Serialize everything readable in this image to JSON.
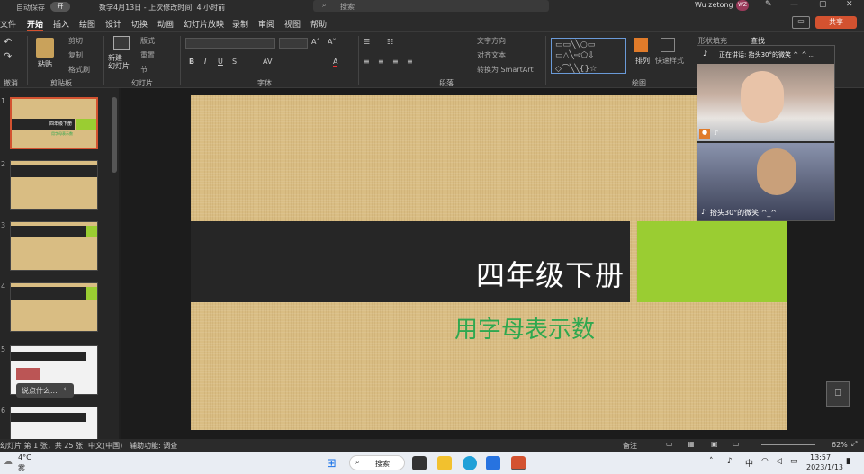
{
  "titlebar": {
    "doc_title": "数学4月13日 - 上次修改时间: 4 小时前",
    "user": "Wu zetong",
    "user_initials": "WZ",
    "autosave_label": "自动保存",
    "autosave_state": "开",
    "search_placeholder": "搜索"
  },
  "menu": [
    "文件",
    "开始",
    "插入",
    "绘图",
    "设计",
    "切换",
    "动画",
    "幻灯片放映",
    "录制",
    "审阅",
    "视图",
    "帮助"
  ],
  "share_label": "共享",
  "ribbon": {
    "groups": [
      {
        "label": "撤消"
      },
      {
        "label": "剪贴板"
      },
      {
        "label": "幻灯片"
      },
      {
        "label": "字体"
      },
      {
        "label": "段落"
      },
      {
        "label": "绘图"
      }
    ],
    "paste": "粘贴",
    "cut": "剪切",
    "copy": "复制",
    "format_painter": "格式刷",
    "new_slide": "新建\n幻灯片",
    "layout": "版式",
    "reset": "重置",
    "section": "节",
    "text_direction": "文字方向",
    "align_text": "对齐文本",
    "smartart": "转换为 SmartArt",
    "arrange": "排列",
    "quick_styles": "快速样式",
    "shape_fill": "形状填充",
    "find": "查找"
  },
  "thumbs": [
    {
      "n": "1"
    },
    {
      "n": "2"
    },
    {
      "n": "3"
    },
    {
      "n": "4"
    },
    {
      "n": "5"
    },
    {
      "n": "6"
    }
  ],
  "thumb1": {
    "title": "四年级下册",
    "sub": "用字母表示数"
  },
  "comment_box": "说点什么...",
  "slide": {
    "title": "四年级下册",
    "subtitle": "用字母表示数"
  },
  "video": {
    "header": "正在讲话: 抬头30°的微笑 ^_^ ...",
    "caption": "抬头30°的微笑 ^_^"
  },
  "status": {
    "slide_info": "幻灯片 第 1 张，共 25 张",
    "language": "中文(中国)",
    "accessibility": "辅助功能: 调查",
    "notes": "备注",
    "zoom": "62%"
  },
  "taskbar": {
    "temp": "4°C",
    "weather": "雾",
    "search": "搜索",
    "ime": "中",
    "time": "13:57",
    "date": "2023/1/13"
  }
}
